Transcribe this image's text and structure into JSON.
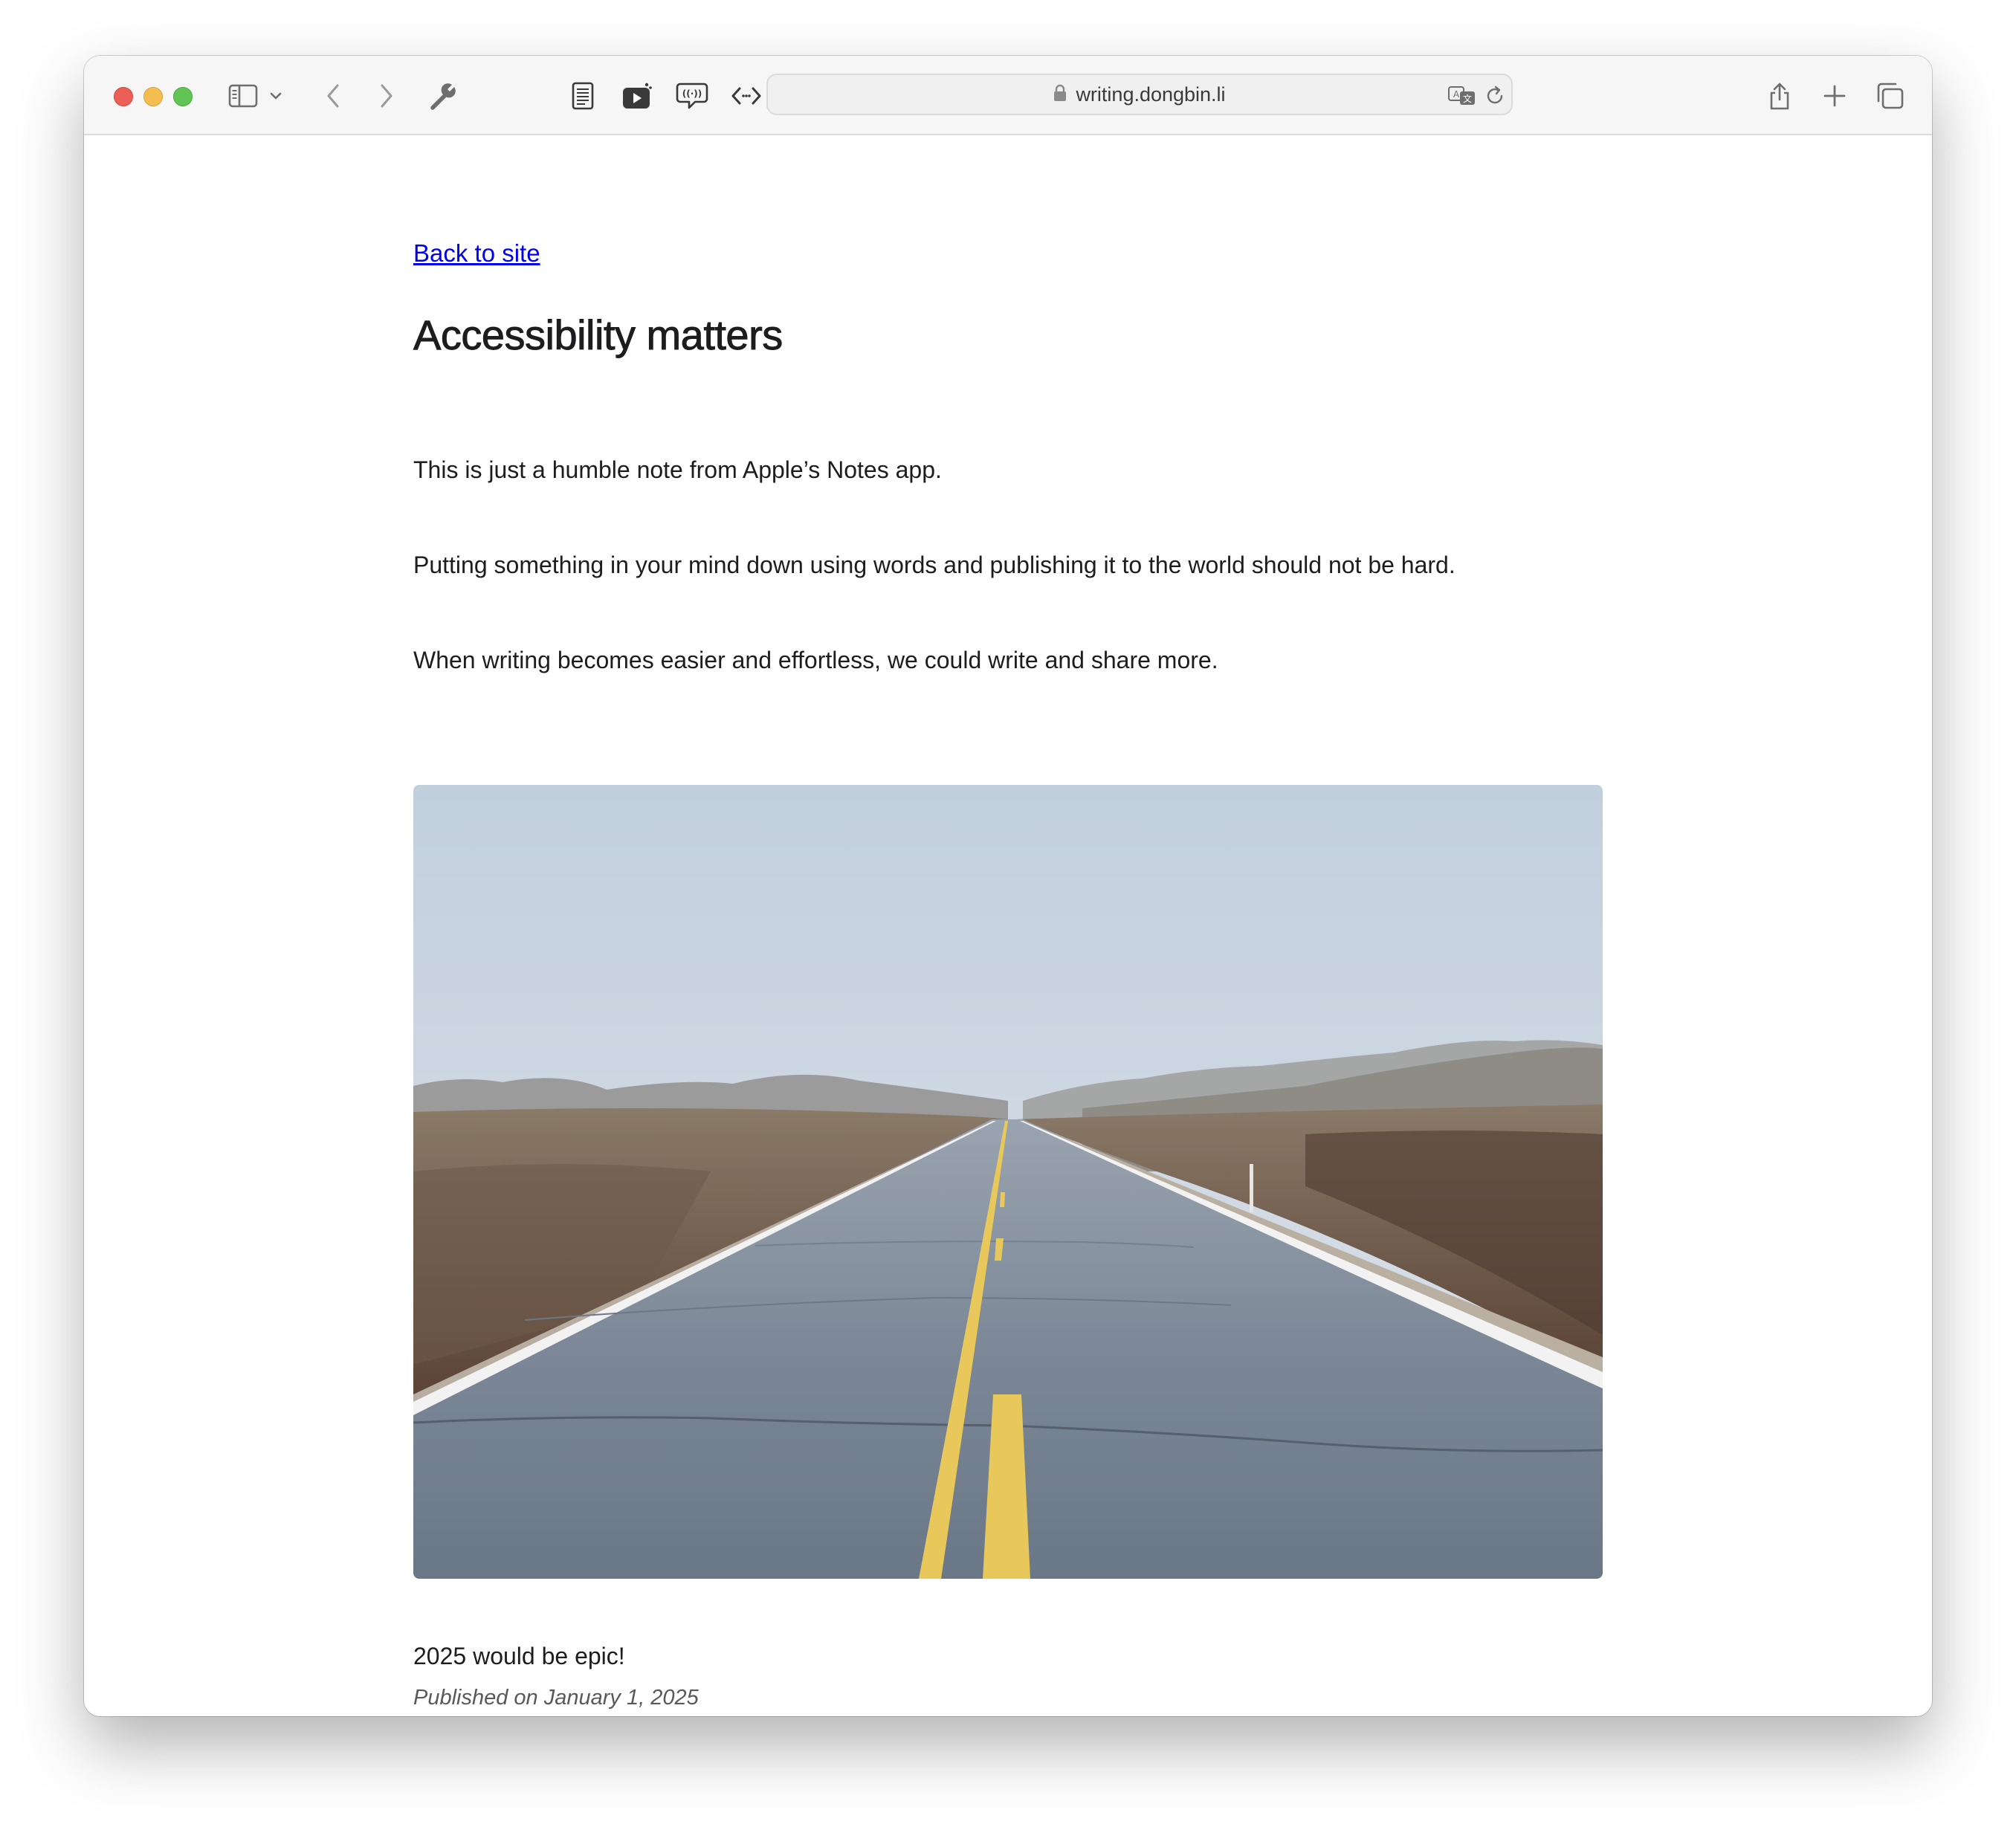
{
  "browser": {
    "url": "writing.dongbin.li",
    "toolbar_icons": [
      "sidebar-icon",
      "chevron-down-icon",
      "back-arrow-icon",
      "forward-arrow-icon",
      "wrench-icon",
      "reader-icon",
      "youtube-icon",
      "speech-bubble-icon",
      "code-icon",
      "pocket-icon",
      "share-icon",
      "plus-icon",
      "tabs-overview-icon"
    ],
    "address_icons": [
      "lock-icon",
      "translate-icon",
      "reload-icon"
    ]
  },
  "page": {
    "back_link": "Back to site",
    "title": "Accessibility matters",
    "paragraphs": [
      "This is just a humble note from Apple’s Notes app.",
      "Putting something in your mind down using words and publishing it to the world should not be hard.",
      "When writing becomes easier and effortless, we could write and share more."
    ],
    "closing": "2025 would be epic!",
    "published": "Published on January 1, 2025"
  },
  "colors": {
    "link": "#0000ee",
    "text": "#1d1d1f",
    "muted": "#595959",
    "pocket": "#2a6ee9"
  }
}
